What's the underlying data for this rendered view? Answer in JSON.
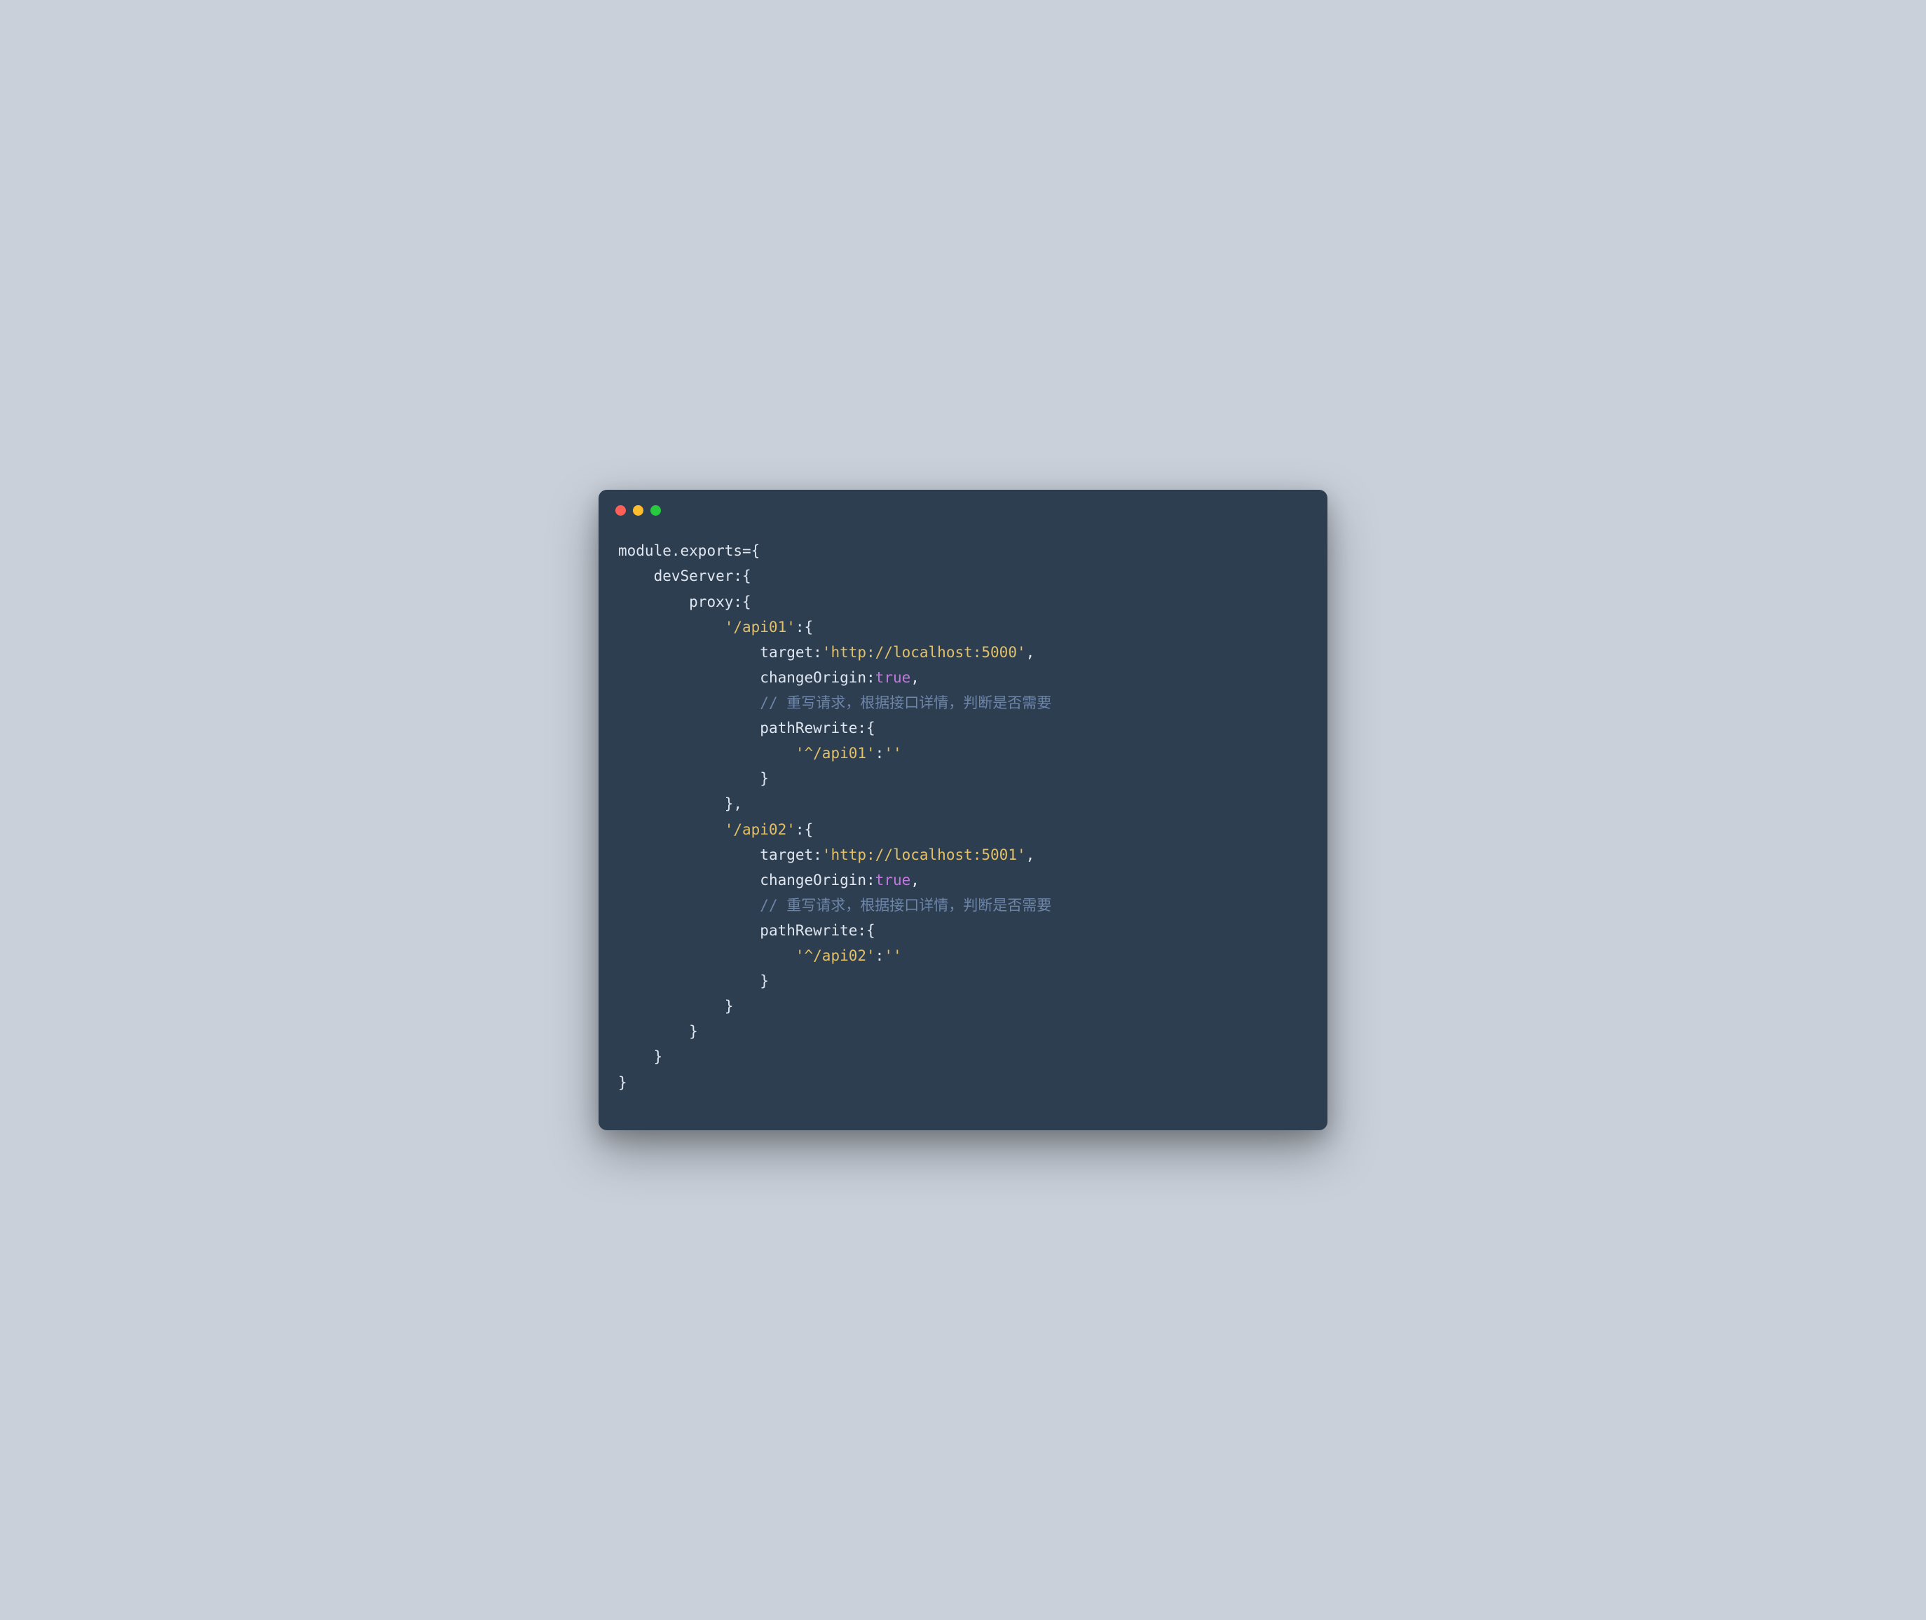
{
  "window": {
    "traffic_lights": {
      "red": "#ff5f56",
      "yellow": "#ffbd2e",
      "green": "#27c93f"
    }
  },
  "code": {
    "line01_module": "module",
    "line01_dot": ".",
    "line01_exports": "exports",
    "line01_eq_brace": "={",
    "line02_indent": "    ",
    "line02_devServer": "devServer",
    "line02_colon_brace": ":{",
    "line03_indent": "        ",
    "line03_proxy": "proxy",
    "line03_colon_brace": ":{",
    "line04_indent": "            ",
    "line04_api01": "'/api01'",
    "line04_colon_brace": ":{",
    "line05_indent": "                ",
    "line05_target": "target",
    "line05_colon": ":",
    "line05_url": "'http://localhost:5000'",
    "line05_comma": ",",
    "line06_indent": "                ",
    "line06_changeOrigin": "changeOrigin",
    "line06_colon": ":",
    "line06_true": "true",
    "line06_comma": ",",
    "line07_indent": "                ",
    "line07_comment": "// 重写请求，根据接口详情，判断是否需要",
    "line08_indent": "                ",
    "line08_pathRewrite": "pathRewrite",
    "line08_colon_brace": ":{",
    "line09_indent": "                    ",
    "line09_key": "'^/api01'",
    "line09_colon": ":",
    "line09_val": "''",
    "line10_indent": "                ",
    "line10_brace": "}",
    "line11_indent": "            ",
    "line11_brace_comma": "},",
    "line12_indent": "            ",
    "line12_api02": "'/api02'",
    "line12_colon_brace": ":{",
    "line13_indent": "                ",
    "line13_target": "target",
    "line13_colon": ":",
    "line13_url": "'http://localhost:5001'",
    "line13_comma": ",",
    "line14_indent": "                ",
    "line14_changeOrigin": "changeOrigin",
    "line14_colon": ":",
    "line14_true": "true",
    "line14_comma": ",",
    "line15_indent": "                ",
    "line15_comment": "// 重写请求，根据接口详情，判断是否需要",
    "line16_indent": "                ",
    "line16_pathRewrite": "pathRewrite",
    "line16_colon_brace": ":{",
    "line17_indent": "                    ",
    "line17_key": "'^/api02'",
    "line17_colon": ":",
    "line17_val": "''",
    "line18_indent": "                ",
    "line18_brace": "}",
    "line19_indent": "            ",
    "line19_brace": "}",
    "line20_indent": "        ",
    "line20_brace": "}",
    "line21_indent": "    ",
    "line21_brace": "}",
    "line22_brace": "}"
  }
}
